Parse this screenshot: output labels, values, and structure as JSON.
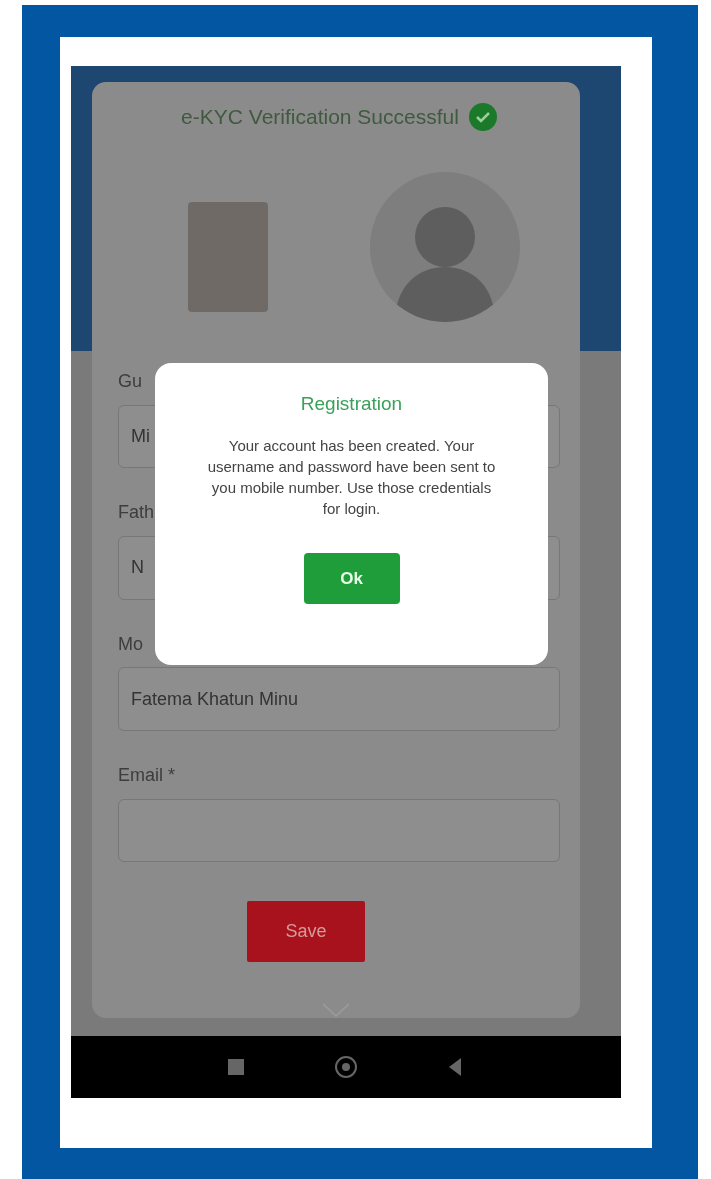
{
  "header": {
    "title": "e-KYC Verification Successful",
    "verified": true
  },
  "form": {
    "fields": [
      {
        "label": "Gu",
        "value": "Mi"
      },
      {
        "label": "Fath",
        "value": "N"
      },
      {
        "label": "Mo",
        "value": "Fatema Khatun Minu"
      },
      {
        "label": "Email *"
      }
    ],
    "save_button": "Save"
  },
  "dialog": {
    "title": "Registration",
    "message": "Your account has been created. Your username and password have been sent to you mobile number. Use those credentials for login.",
    "ok_button": "Ok"
  }
}
